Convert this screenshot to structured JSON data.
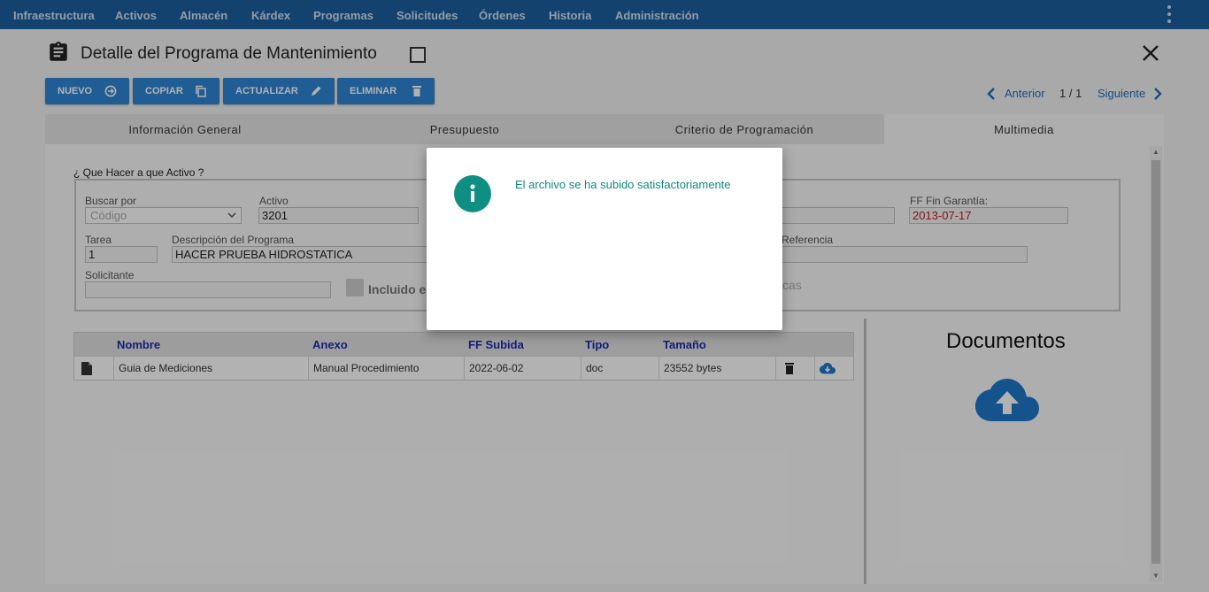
{
  "nav": {
    "items": [
      "Infraestructura",
      "Activos",
      "Almacén",
      "Kárdex",
      "Programas",
      "Solicitudes",
      "Órdenes",
      "Historia",
      "Administración"
    ]
  },
  "header": {
    "title": "Detalle del Programa de Mantenimiento"
  },
  "toolbar": {
    "nuevo": "NUEVO",
    "copiar": "COPIAR",
    "actualizar": "ACTUALIZAR",
    "eliminar": "ELIMINAR"
  },
  "pager": {
    "prev": "Anterior",
    "count": "1 / 1",
    "next": "Siguiente"
  },
  "tabs": [
    "Información General",
    "Presupuesto",
    "Criterio de Programación",
    "Multimedia"
  ],
  "active_tab": "Multimedia",
  "form": {
    "section_title": "¿ Que Hacer a que Activo ?",
    "buscar_por_label": "Buscar por",
    "buscar_por_value": "Código",
    "activo_label": "Activo",
    "activo_value": "3201",
    "ff_fin_garantia_label": "FF Fin Garantía:",
    "ff_fin_garantia_value": "2013-07-17",
    "tarea_label": "Tarea",
    "tarea_value": "1",
    "descripcion_label": "Descripción del Programa",
    "descripcion_value": "HACER PRUEBA HIDROSTATICA",
    "referencia_label": "Referencia",
    "solicitante_label": "Solicitante",
    "incluido_label": "Incluido e",
    "cas_label": "cas"
  },
  "table": {
    "headers": [
      "Nombre",
      "Anexo",
      "FF Subida",
      "Tipo",
      "Tamaño"
    ],
    "rows": [
      {
        "nombre": "Guia de Mediciones",
        "anexo": "Manual Procedimiento",
        "ff_subida": "2022-06-02",
        "tipo": "doc",
        "tamano": "23552 bytes"
      }
    ]
  },
  "documents": {
    "title": "Documentos"
  },
  "dialog": {
    "message": "El archivo se ha subido satisfactoriamente"
  },
  "colors": {
    "nav_bg": "#1e5fa0",
    "button_bg": "#2e86d4",
    "accent": "#1e6fc0",
    "info_teal": "#0f8f82",
    "date_red": "#c81b1b"
  }
}
